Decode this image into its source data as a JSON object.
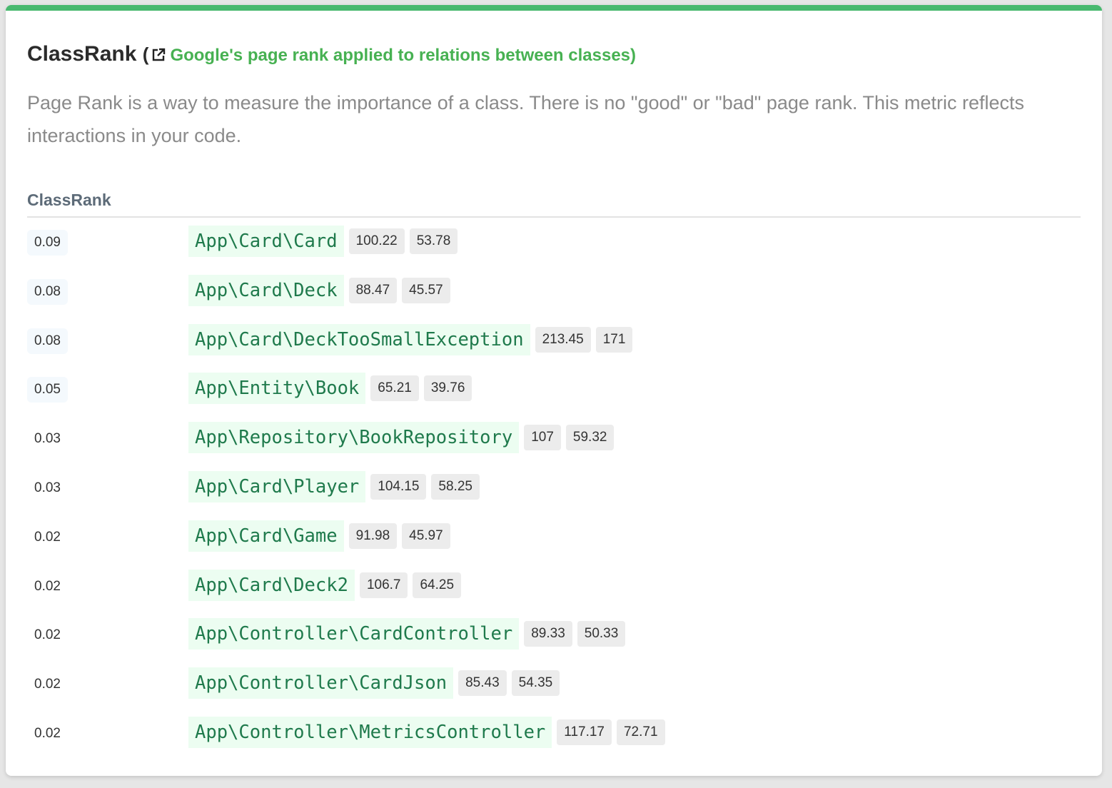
{
  "title": "ClassRank",
  "paren_open": "(",
  "link_text": "Google's page rank applied to relations between classes)",
  "description": "Page Rank is a way to measure the importance of a class. There is no \"good\" or \"bad\" page rank. This metric reflects interactions in your code.",
  "column_header": "ClassRank",
  "rows": [
    {
      "rank": "0.09",
      "class": "App\\Card\\Card",
      "a": "100.22",
      "b": "53.78",
      "highlight": true
    },
    {
      "rank": "0.08",
      "class": "App\\Card\\Deck",
      "a": "88.47",
      "b": "45.57",
      "highlight": true
    },
    {
      "rank": "0.08",
      "class": "App\\Card\\DeckTooSmallException",
      "a": "213.45",
      "b": "171",
      "highlight": true
    },
    {
      "rank": "0.05",
      "class": "App\\Entity\\Book",
      "a": "65.21",
      "b": "39.76",
      "highlight": true
    },
    {
      "rank": "0.03",
      "class": "App\\Repository\\BookRepository",
      "a": "107",
      "b": "59.32",
      "highlight": false
    },
    {
      "rank": "0.03",
      "class": "App\\Card\\Player",
      "a": "104.15",
      "b": "58.25",
      "highlight": false
    },
    {
      "rank": "0.02",
      "class": "App\\Card\\Game",
      "a": "91.98",
      "b": "45.97",
      "highlight": false
    },
    {
      "rank": "0.02",
      "class": "App\\Card\\Deck2",
      "a": "106.7",
      "b": "64.25",
      "highlight": false
    },
    {
      "rank": "0.02",
      "class": "App\\Controller\\CardController",
      "a": "89.33",
      "b": "50.33",
      "highlight": false
    },
    {
      "rank": "0.02",
      "class": "App\\Controller\\CardJson",
      "a": "85.43",
      "b": "54.35",
      "highlight": false
    },
    {
      "rank": "0.02",
      "class": "App\\Controller\\MetricsController",
      "a": "117.17",
      "b": "72.71",
      "highlight": false
    }
  ],
  "colors": {
    "accent": "#48b96f",
    "link": "#47b152",
    "class_text": "#1f7a4c"
  },
  "icons": {
    "link": "external-link-icon"
  }
}
